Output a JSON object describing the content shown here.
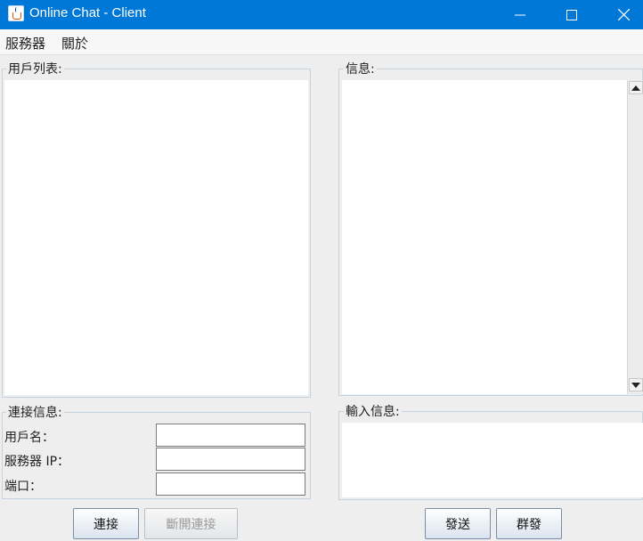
{
  "window": {
    "title": "Online Chat - Client",
    "accent_color": "#0078d7",
    "controls": [
      "minimize-icon",
      "maximize-icon",
      "close-icon"
    ]
  },
  "menu": {
    "items": [
      {
        "label": "服務器"
      },
      {
        "label": "關於"
      }
    ]
  },
  "user_list": {
    "title": "用戶列表:",
    "items": []
  },
  "messages": {
    "title": "信息:",
    "content": ""
  },
  "connection": {
    "title": "連接信息:",
    "username_label": "用戶名：",
    "username_value": "",
    "server_ip_label": "服務器 IP：",
    "server_ip_value": "",
    "port_label": "端口：",
    "port_value": ""
  },
  "input": {
    "title": "輸入信息:",
    "value": ""
  },
  "buttons": {
    "connect": "連接",
    "disconnect": "斷開連接",
    "send": "發送",
    "broadcast": "群發"
  }
}
